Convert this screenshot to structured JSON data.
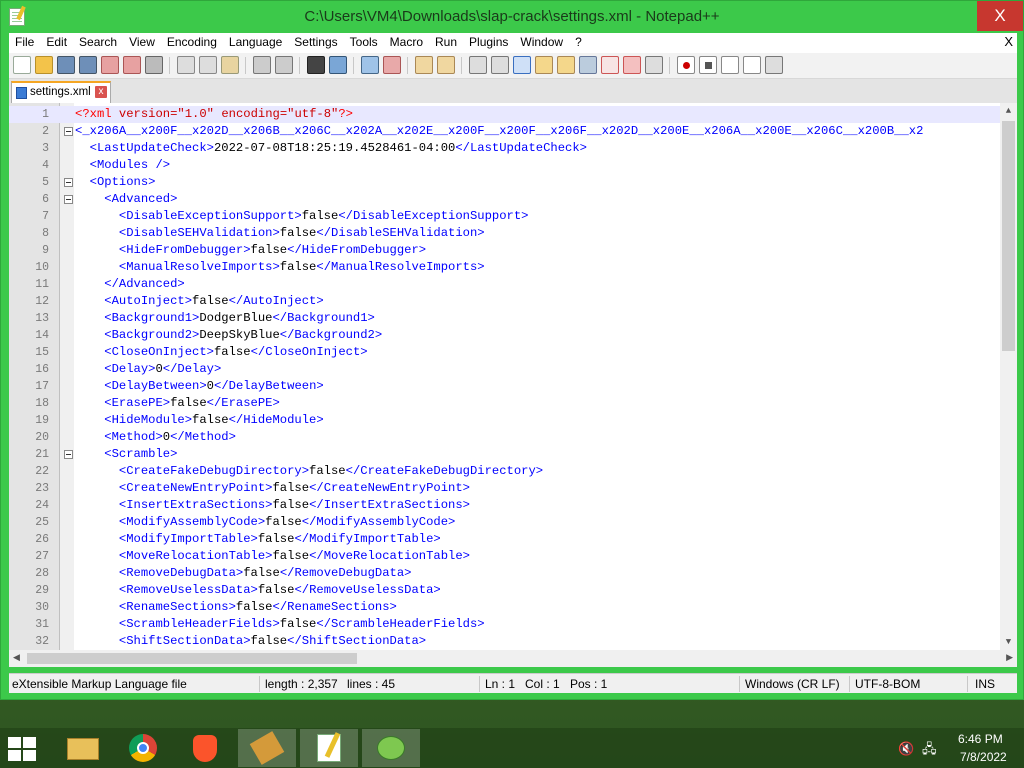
{
  "window": {
    "title": "C:\\Users\\VM4\\Downloads\\slap-crack\\settings.xml - Notepad++",
    "close": "X"
  },
  "menu": [
    "File",
    "Edit",
    "Search",
    "View",
    "Encoding",
    "Language",
    "Settings",
    "Tools",
    "Macro",
    "Run",
    "Plugins",
    "Window",
    "?"
  ],
  "menu_close": "X",
  "tab": {
    "label": "settings.xml",
    "close": "x"
  },
  "editor": {
    "lines": [
      {
        "n": "1",
        "html": "<span class='pi'>&lt;?xml</span> <span class='at'>version=&quot;1.0&quot;</span> <span class='at'>encoding=&quot;utf-8&quot;</span><span class='pi'>?&gt;</span>",
        "fold": false
      },
      {
        "n": "2",
        "html": "<span class='t'>&lt;_x206A__x200F__x202D__x206B__x206C__x202A__x202E__x200F__x200F__x206F__x202D__x200E__x206A__x200E__x206C__x200B__x2</span>",
        "fold": true
      },
      {
        "n": "3",
        "html": "  <span class='t'>&lt;LastUpdateCheck&gt;</span>2022-07-08T18:25:19.4528461-04:00<span class='t'>&lt;/LastUpdateCheck&gt;</span>",
        "fold": false
      },
      {
        "n": "4",
        "html": "  <span class='t'>&lt;Modules /&gt;</span>",
        "fold": false
      },
      {
        "n": "5",
        "html": "  <span class='t'>&lt;Options&gt;</span>",
        "fold": true
      },
      {
        "n": "6",
        "html": "    <span class='t'>&lt;Advanced&gt;</span>",
        "fold": true
      },
      {
        "n": "7",
        "html": "      <span class='t'>&lt;DisableExceptionSupport&gt;</span>false<span class='t'>&lt;/DisableExceptionSupport&gt;</span>",
        "fold": false
      },
      {
        "n": "8",
        "html": "      <span class='t'>&lt;DisableSEHValidation&gt;</span>false<span class='t'>&lt;/DisableSEHValidation&gt;</span>",
        "fold": false
      },
      {
        "n": "9",
        "html": "      <span class='t'>&lt;HideFromDebugger&gt;</span>false<span class='t'>&lt;/HideFromDebugger&gt;</span>",
        "fold": false
      },
      {
        "n": "10",
        "html": "      <span class='t'>&lt;ManualResolveImports&gt;</span>false<span class='t'>&lt;/ManualResolveImports&gt;</span>",
        "fold": false
      },
      {
        "n": "11",
        "html": "    <span class='t'>&lt;/Advanced&gt;</span>",
        "fold": false
      },
      {
        "n": "12",
        "html": "    <span class='t'>&lt;AutoInject&gt;</span>false<span class='t'>&lt;/AutoInject&gt;</span>",
        "fold": false
      },
      {
        "n": "13",
        "html": "    <span class='t'>&lt;Background1&gt;</span>DodgerBlue<span class='t'>&lt;/Background1&gt;</span>",
        "fold": false
      },
      {
        "n": "14",
        "html": "    <span class='t'>&lt;Background2&gt;</span>DeepSkyBlue<span class='t'>&lt;/Background2&gt;</span>",
        "fold": false
      },
      {
        "n": "15",
        "html": "    <span class='t'>&lt;CloseOnInject&gt;</span>false<span class='t'>&lt;/CloseOnInject&gt;</span>",
        "fold": false
      },
      {
        "n": "16",
        "html": "    <span class='t'>&lt;Delay&gt;</span>0<span class='t'>&lt;/Delay&gt;</span>",
        "fold": false
      },
      {
        "n": "17",
        "html": "    <span class='t'>&lt;DelayBetween&gt;</span>0<span class='t'>&lt;/DelayBetween&gt;</span>",
        "fold": false
      },
      {
        "n": "18",
        "html": "    <span class='t'>&lt;ErasePE&gt;</span>false<span class='t'>&lt;/ErasePE&gt;</span>",
        "fold": false
      },
      {
        "n": "19",
        "html": "    <span class='t'>&lt;HideModule&gt;</span>false<span class='t'>&lt;/HideModule&gt;</span>",
        "fold": false
      },
      {
        "n": "20",
        "html": "    <span class='t'>&lt;Method&gt;</span>0<span class='t'>&lt;/Method&gt;</span>",
        "fold": false
      },
      {
        "n": "21",
        "html": "    <span class='t'>&lt;Scramble&gt;</span>",
        "fold": true
      },
      {
        "n": "22",
        "html": "      <span class='t'>&lt;CreateFakeDebugDirectory&gt;</span>false<span class='t'>&lt;/CreateFakeDebugDirectory&gt;</span>",
        "fold": false
      },
      {
        "n": "23",
        "html": "      <span class='t'>&lt;CreateNewEntryPoint&gt;</span>false<span class='t'>&lt;/CreateNewEntryPoint&gt;</span>",
        "fold": false
      },
      {
        "n": "24",
        "html": "      <span class='t'>&lt;InsertExtraSections&gt;</span>false<span class='t'>&lt;/InsertExtraSections&gt;</span>",
        "fold": false
      },
      {
        "n": "25",
        "html": "      <span class='t'>&lt;ModifyAssemblyCode&gt;</span>false<span class='t'>&lt;/ModifyAssemblyCode&gt;</span>",
        "fold": false
      },
      {
        "n": "26",
        "html": "      <span class='t'>&lt;ModifyImportTable&gt;</span>false<span class='t'>&lt;/ModifyImportTable&gt;</span>",
        "fold": false
      },
      {
        "n": "27",
        "html": "      <span class='t'>&lt;MoveRelocationTable&gt;</span>false<span class='t'>&lt;/MoveRelocationTable&gt;</span>",
        "fold": false
      },
      {
        "n": "28",
        "html": "      <span class='t'>&lt;RemoveDebugData&gt;</span>false<span class='t'>&lt;/RemoveDebugData&gt;</span>",
        "fold": false
      },
      {
        "n": "29",
        "html": "      <span class='t'>&lt;RemoveUselessData&gt;</span>false<span class='t'>&lt;/RemoveUselessData&gt;</span>",
        "fold": false
      },
      {
        "n": "30",
        "html": "      <span class='t'>&lt;RenameSections&gt;</span>false<span class='t'>&lt;/RenameSections&gt;</span>",
        "fold": false
      },
      {
        "n": "31",
        "html": "      <span class='t'>&lt;ScrambleHeaderFields&gt;</span>false<span class='t'>&lt;/ScrambleHeaderFields&gt;</span>",
        "fold": false
      },
      {
        "n": "32",
        "html": "      <span class='t'>&lt;ShiftSectionData&gt;</span>false<span class='t'>&lt;/ShiftSectionData&gt;</span>",
        "fold": false
      }
    ]
  },
  "status": {
    "file_type": "eXtensible Markup Language file",
    "length": "length : 2,357",
    "lines": "lines : 45",
    "ln": "Ln : 1",
    "col": "Col : 1",
    "pos": "Pos : 1",
    "eol": "Windows (CR LF)",
    "encoding": "UTF-8-BOM",
    "mode": "INS"
  },
  "taskbar": {
    "time": "6:46 PM",
    "date": "7/8/2022"
  },
  "colors": {
    "title_bg": "#3cc94a",
    "tag": "#0000ff",
    "pi": "#ff0000"
  }
}
